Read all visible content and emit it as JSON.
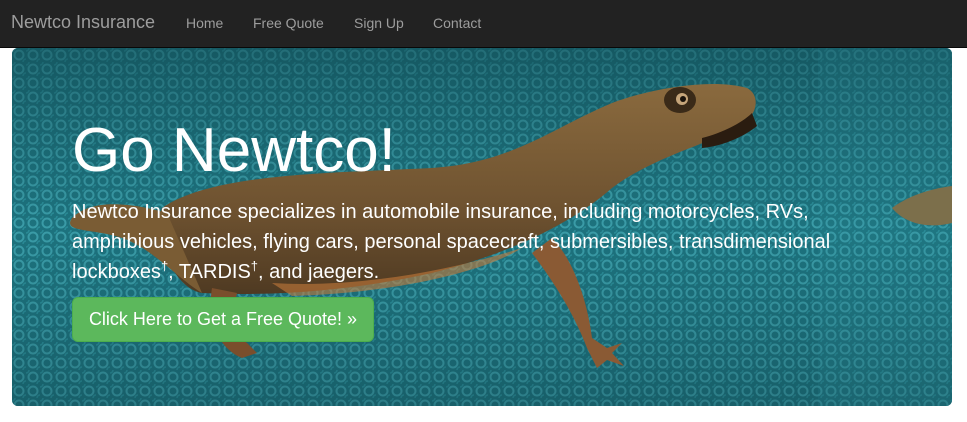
{
  "navbar": {
    "brand": "Newtco Insurance",
    "links": [
      {
        "label": "Home"
      },
      {
        "label": "Free Quote"
      },
      {
        "label": "Sign Up"
      },
      {
        "label": "Contact"
      }
    ],
    "background": "#222222",
    "link_color": "#9d9d9d"
  },
  "hero": {
    "title": "Go Newtco!",
    "description_part1": "Newtco Insurance specializes in automobile insurance, including motorcycles, RVs, amphibious vehicles, flying cars, personal spacecraft, submersibles, transdimensional lockboxes",
    "dagger": "†",
    "description_part2": ", TARDIS",
    "description_part3": ", and jaegers.",
    "cta_label": "Click Here to Get a Free Quote! »",
    "cta_color": "#5cb85c",
    "background_image": "newt-on-turquoise-mat"
  }
}
